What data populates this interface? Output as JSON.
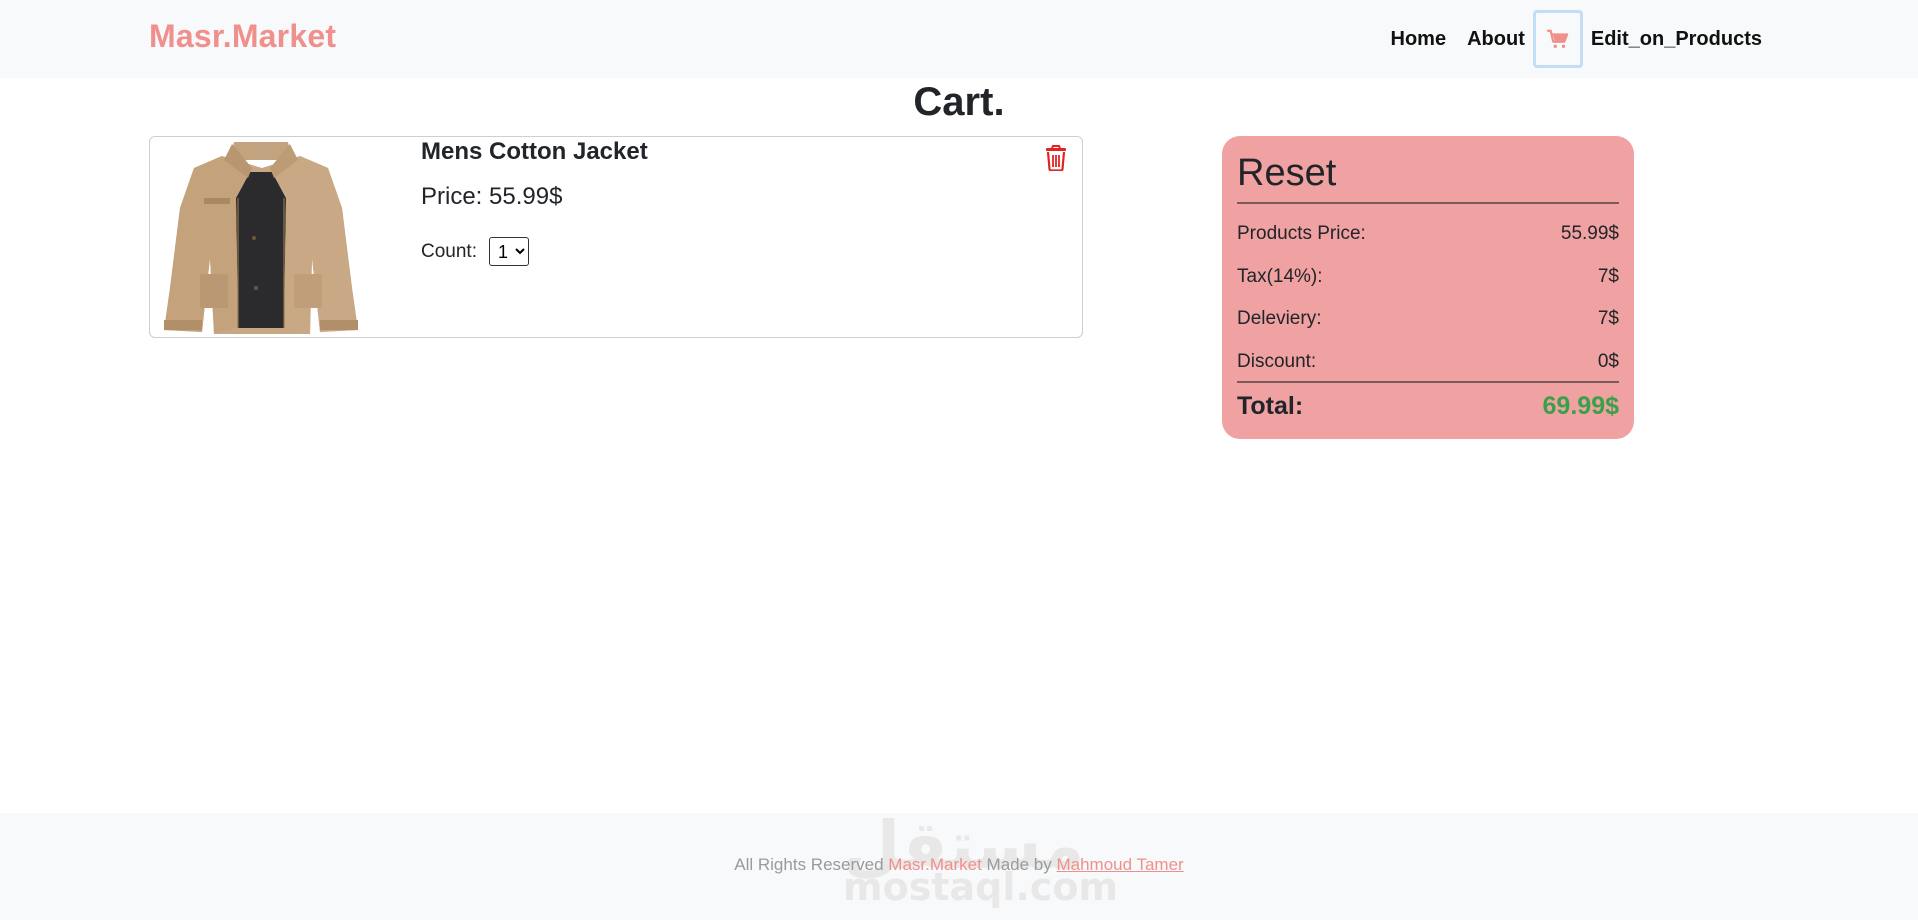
{
  "navbar": {
    "brand": "Masr.Market",
    "links": {
      "home": "Home",
      "about": "About",
      "edit_products": "Edit_on_Products"
    },
    "cart_icon": "shopping-cart-icon"
  },
  "page": {
    "title": "Cart."
  },
  "cart": {
    "items": [
      {
        "name": "Mens Cotton Jacket",
        "price_text": "Price: 55.99$",
        "count_label": "Count:",
        "count_value": "1",
        "image": "jacket-image",
        "delete_icon": "trash-icon"
      }
    ]
  },
  "receipt": {
    "title": "Reset",
    "rows": {
      "products_price": {
        "label": "Products Price:",
        "value": "55.99$"
      },
      "tax": {
        "label": "Tax(14%):",
        "value": "7$"
      },
      "delivery": {
        "label": "Deleviery:",
        "value": "7$"
      },
      "discount": {
        "label": "Discount:",
        "value": "0$"
      }
    },
    "total": {
      "label": "Total:",
      "value": "69.99$"
    }
  },
  "footer": {
    "prefix": "All Rights Reserved ",
    "brand": "Masr.Market",
    "made_by": " Made by ",
    "author": "Mahmoud Tamer"
  },
  "watermark": {
    "arabic": "مستقل",
    "latin": "mostaql.com"
  },
  "colors": {
    "brand": "#f0908c",
    "receipt_bg": "#f0a1a1",
    "total": "#3aa04a",
    "delete": "#e02424",
    "navbar_bg": "#f8f9fa"
  }
}
